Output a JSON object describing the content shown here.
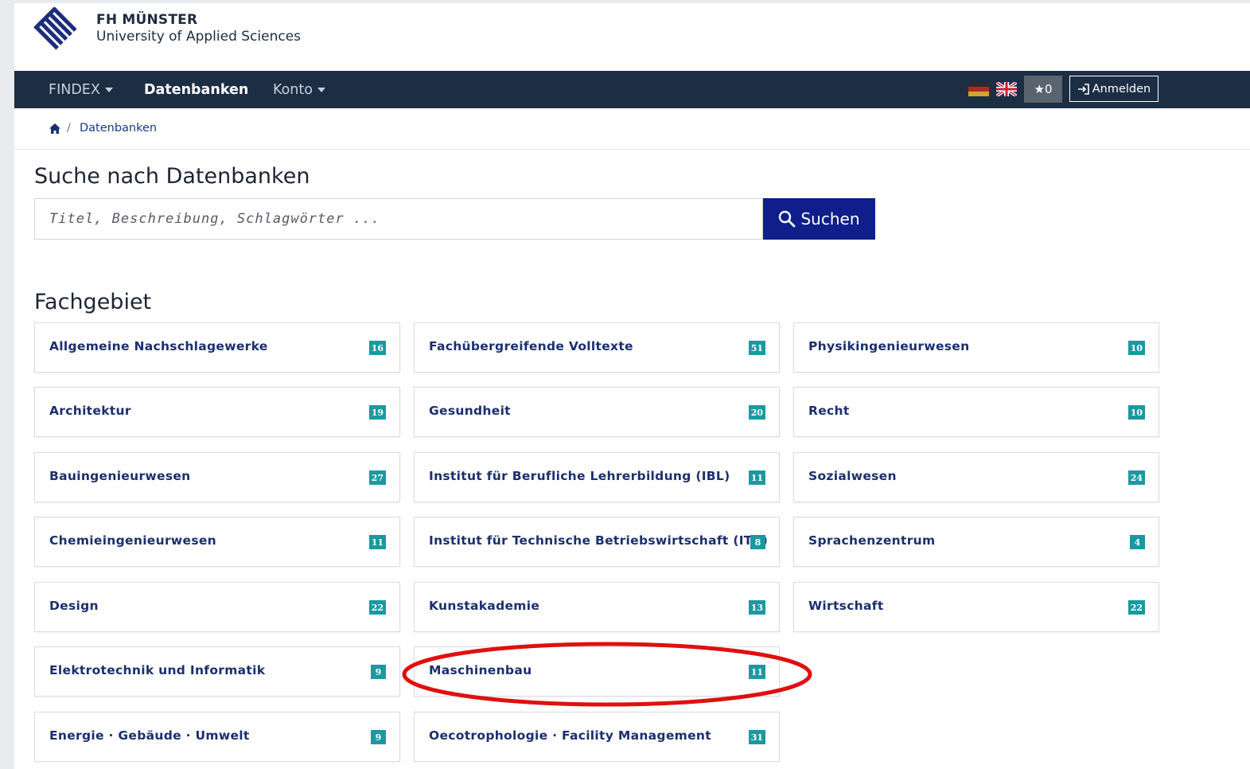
{
  "brand": {
    "name": "FH MÜNSTER",
    "subtitle": "University of Applied Sciences"
  },
  "nav": {
    "items": [
      {
        "label": "FINDEX",
        "dropdown": true,
        "active": false
      },
      {
        "label": "Datenbanken",
        "dropdown": false,
        "active": true
      },
      {
        "label": "Konto",
        "dropdown": true,
        "active": false
      }
    ],
    "flags": [
      "german-flag-icon",
      "uk-flag-icon"
    ],
    "favorites_count": "0",
    "login_label": "Anmelden"
  },
  "breadcrumb": {
    "home_icon": "home-icon",
    "separator": "/",
    "current": "Datenbanken"
  },
  "search": {
    "heading": "Suche nach Datenbanken",
    "placeholder": "Titel, Beschreibung, Schlagwörter ...",
    "value": "",
    "button_label": "Suchen"
  },
  "subjects": {
    "heading": "Fachgebiet",
    "columns": [
      [
        {
          "label": "Allgemeine Nachschlagewerke",
          "count": "16"
        },
        {
          "label": "Architektur",
          "count": "19"
        },
        {
          "label": "Bauingenieurwesen",
          "count": "27"
        },
        {
          "label": "Chemieingenieurwesen",
          "count": "11"
        },
        {
          "label": "Design",
          "count": "22"
        },
        {
          "label": "Elektrotechnik und Informatik",
          "count": "9"
        },
        {
          "label": "Energie · Gebäude · Umwelt",
          "count": "9"
        }
      ],
      [
        {
          "label": "Fachübergreifende Volltexte",
          "count": "51"
        },
        {
          "label": "Gesundheit",
          "count": "20"
        },
        {
          "label": "Institut für Berufliche Lehrerbildung (IBL)",
          "count": "11"
        },
        {
          "label": "Institut für Technische Betriebswirtschaft (ITB)",
          "count": "8"
        },
        {
          "label": "Kunstakademie",
          "count": "13"
        },
        {
          "label": "Maschinenbau",
          "count": "11"
        },
        {
          "label": "Oecotrophologie · Facility Management",
          "count": "31"
        }
      ],
      [
        {
          "label": "Physikingenieurwesen",
          "count": "10"
        },
        {
          "label": "Recht",
          "count": "10"
        },
        {
          "label": "Sozialwesen",
          "count": "24"
        },
        {
          "label": "Sprachenzentrum",
          "count": "4"
        },
        {
          "label": "Wirtschaft",
          "count": "22"
        }
      ]
    ]
  },
  "annotation": {
    "highlighted_item": "Maschinenbau",
    "color": "#e01010"
  },
  "colors": {
    "navbar": "#1c2e44",
    "search_button": "#0f1e8a",
    "badge": "#1a9aa0",
    "link": "#1b2f6e"
  }
}
